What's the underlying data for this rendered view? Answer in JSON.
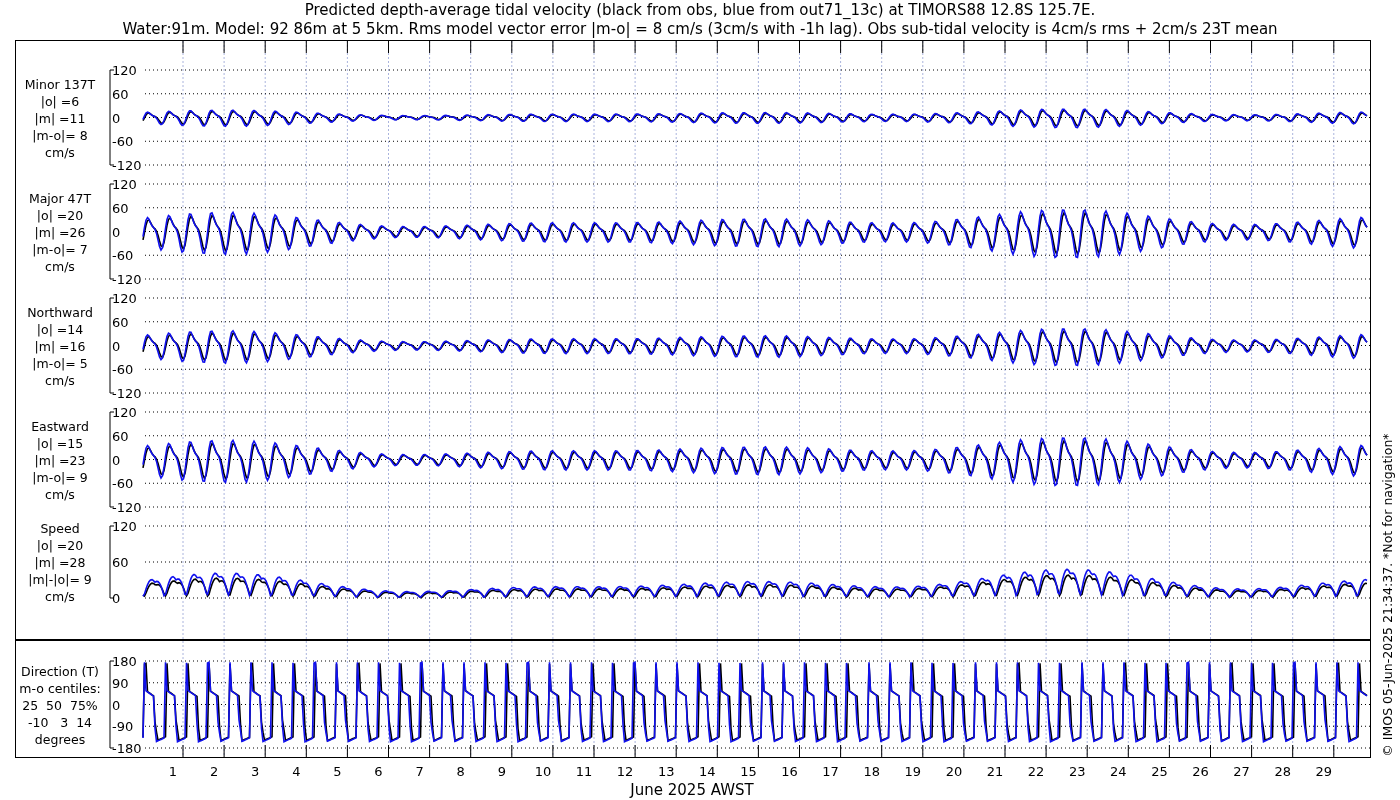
{
  "title_lines": [
    "Predicted depth-average tidal velocity (black from obs, blue from out71_13c) at TIMORS88 12.8S 125.7E.",
    "Water:91m. Model: 92 86m at 5 5km. Rms model vector error |m-o| = 8 cm/s (3cm/s with -1h lag). Obs sub-tidal velocity is 4cm/s rms + 2cm/s 23T mean"
  ],
  "panels": [
    {
      "kind": "velocity",
      "label_lines": [
        "Minor 137T",
        "|o| =6",
        "|m| =11",
        "|m-o|= 8",
        "cm/s"
      ],
      "yticks": [
        "120",
        "60",
        "0",
        "-60",
        "-120"
      ]
    },
    {
      "kind": "velocity",
      "label_lines": [
        "Major 47T",
        "|o| =20",
        "|m| =26",
        "|m-o|= 7",
        "cm/s"
      ],
      "yticks": [
        "120",
        "60",
        "0",
        "-60",
        "-120"
      ]
    },
    {
      "kind": "velocity",
      "label_lines": [
        "Northward",
        "|o| =14",
        "|m| =16",
        "|m-o|= 5",
        "cm/s"
      ],
      "yticks": [
        "120",
        "60",
        "0",
        "-60",
        "-120"
      ]
    },
    {
      "kind": "velocity",
      "label_lines": [
        "Eastward",
        "|o| =15",
        "|m| =23",
        "|m-o|= 9",
        "cm/s"
      ],
      "yticks": [
        "120",
        "60",
        "0",
        "-60",
        "-120"
      ]
    },
    {
      "kind": "speed",
      "label_lines": [
        "Speed",
        "|o| =20",
        "|m| =28",
        "|m|-|o|= 9",
        "cm/s"
      ],
      "yticks": [
        "120",
        "60",
        "0"
      ]
    },
    {
      "kind": "direction",
      "label_lines": [
        "Direction (T)",
        "m-o centiles:",
        "25  50  75%",
        "-10   3  14",
        "degrees"
      ],
      "yticks": [
        "180",
        "90",
        "0",
        "-90",
        "-180"
      ]
    }
  ],
  "x_tick_labels": [
    "1",
    "2",
    "3",
    "4",
    "5",
    "6",
    "7",
    "8",
    "9",
    "10",
    "11",
    "12",
    "13",
    "14",
    "15",
    "16",
    "17",
    "18",
    "19",
    "20",
    "21",
    "22",
    "23",
    "24",
    "25",
    "26",
    "27",
    "28",
    "29"
  ],
  "xlabel": "June 2025 AWST",
  "side_note": "© IMOS 05-Jun-2025 21:34:37. *Not for navigation*"
}
